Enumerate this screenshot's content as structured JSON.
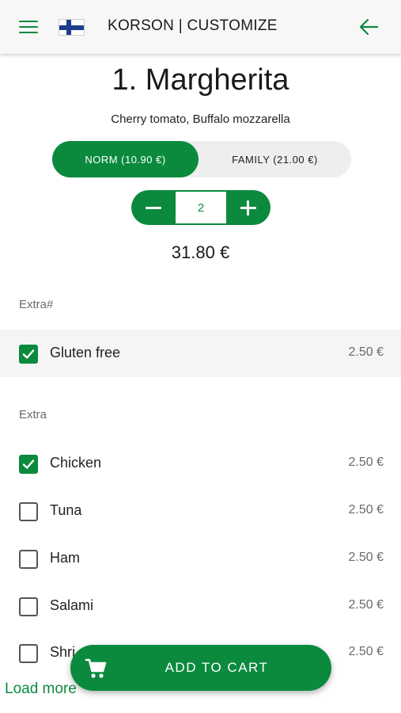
{
  "appbar": {
    "title": "KORSON | CUSTOMIZE",
    "menu_icon": "hamburger-menu-icon",
    "flag_icon": "finland-flag-icon",
    "back_icon": "arrow-left-icon"
  },
  "product": {
    "title": "1. Margherita",
    "description": "Cherry tomato, Buffalo mozzarella",
    "sizes": [
      {
        "label": "NORM (10.90 €)",
        "selected": true
      },
      {
        "label": "FAMILY (21.00 €)",
        "selected": false
      }
    ],
    "quantity": "2",
    "total": "31.80 €"
  },
  "groups": [
    {
      "label": "Extra#",
      "options": [
        {
          "name": "Gluten free",
          "price": "2.50 €",
          "checked": true
        }
      ]
    },
    {
      "label": "Extra",
      "options": [
        {
          "name": "Chicken",
          "price": "2.50 €",
          "checked": true
        },
        {
          "name": "Tuna",
          "price": "2.50 €",
          "checked": false
        },
        {
          "name": "Ham",
          "price": "2.50 €",
          "checked": false
        },
        {
          "name": "Salami",
          "price": "2.50 €",
          "checked": false
        },
        {
          "name": "Shri",
          "price": "2.50 €",
          "checked": false
        }
      ]
    }
  ],
  "add_to_cart_label": "ADD TO CART",
  "cart_icon": "shopping-cart-icon",
  "load_more_label": "Load more",
  "colors": {
    "accent": "#0b8a3e",
    "muted_text": "#6b6b6b",
    "row_shade": "#f5f5f5"
  }
}
